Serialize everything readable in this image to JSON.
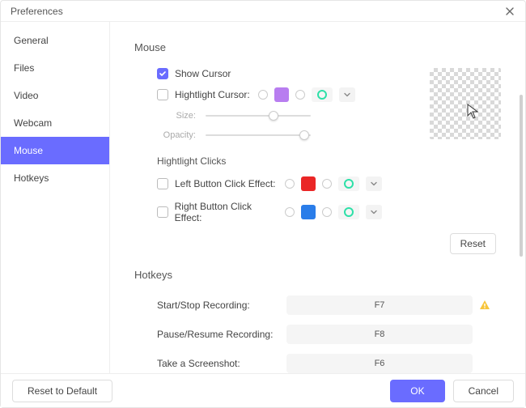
{
  "window": {
    "title": "Preferences"
  },
  "sidebar": {
    "items": [
      {
        "label": "General"
      },
      {
        "label": "Files"
      },
      {
        "label": "Video"
      },
      {
        "label": "Webcam"
      },
      {
        "label": "Mouse",
        "active": true
      },
      {
        "label": "Hotkeys"
      }
    ]
  },
  "mouse": {
    "title": "Mouse",
    "show_cursor_label": "Show Cursor",
    "highlight_cursor_label": "Hightlight Cursor:",
    "highlight_cursor_color": "#b87df0",
    "size_label": "Size:",
    "opacity_label": "Opacity:",
    "clicks_title": "Hightlight Clicks",
    "left_effect_label": "Left Button Click Effect:",
    "left_color": "#ea2626",
    "right_effect_label": "Right Button Click Effect:",
    "right_color": "#2a7de9",
    "ring_color": "#2ee0a8",
    "reset_label": "Reset"
  },
  "hotkeys": {
    "title": "Hotkeys",
    "items": [
      {
        "label": "Start/Stop Recording:",
        "key": "F7",
        "warn": true
      },
      {
        "label": "Pause/Resume Recording:",
        "key": "F8"
      },
      {
        "label": "Take a Screenshot:",
        "key": "F6"
      }
    ]
  },
  "footer": {
    "reset_default": "Reset to Default",
    "ok": "OK",
    "cancel": "Cancel"
  }
}
